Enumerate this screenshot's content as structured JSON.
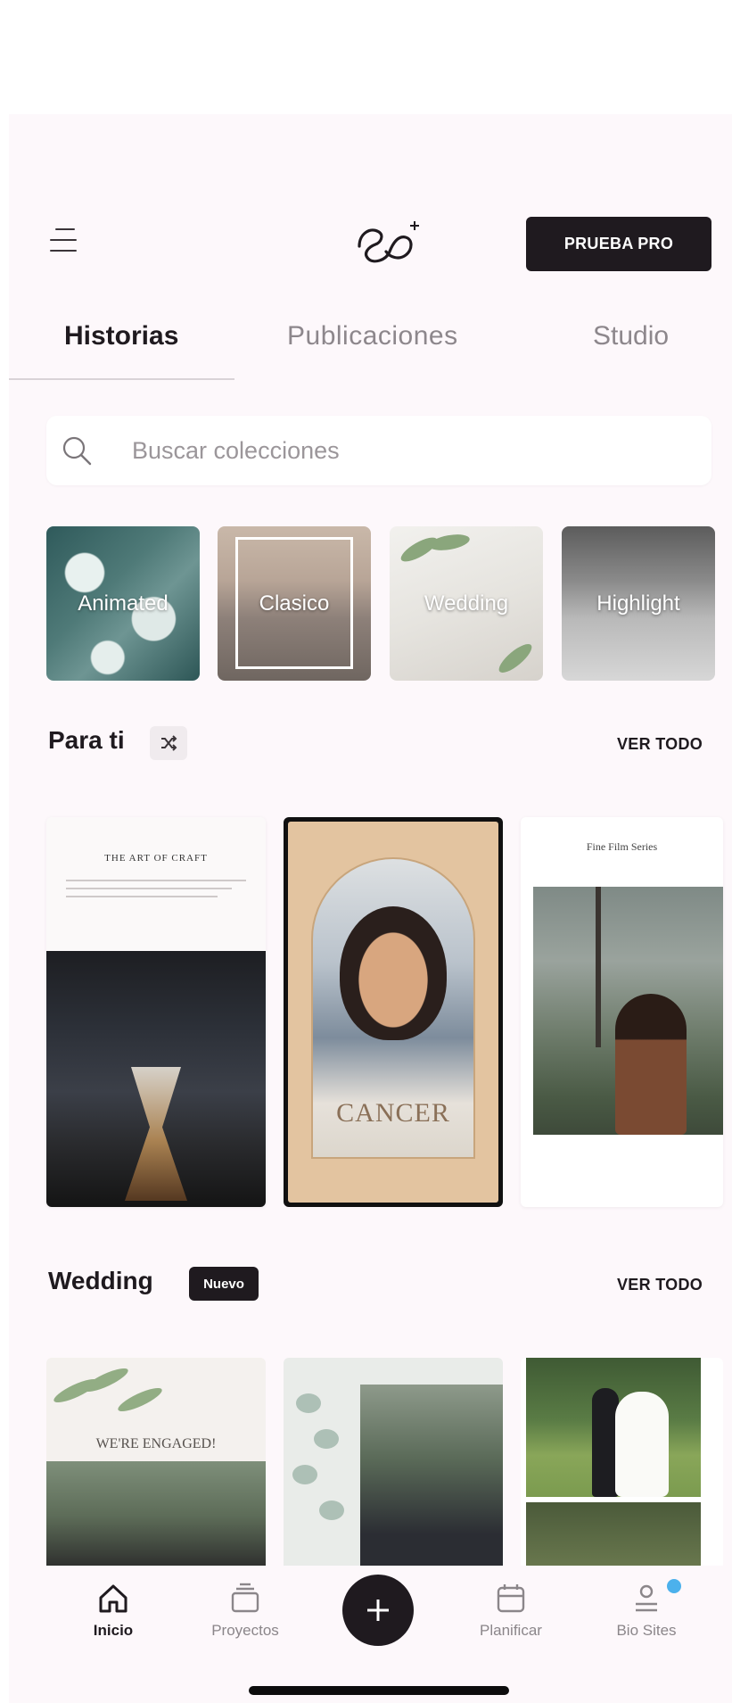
{
  "header": {
    "pro_button": "PRUEBA PRO"
  },
  "tabs": [
    "Historias",
    "Publicaciones",
    "Studio"
  ],
  "search": {
    "placeholder": "Buscar colecciones"
  },
  "collections": [
    "Animated",
    "Clasico",
    "Wedding",
    "Highlight"
  ],
  "sections": {
    "for_you": {
      "title": "Para ti",
      "see_all": "VER TODO",
      "cards": {
        "craft_title": "THE ART OF CRAFT",
        "cancer_word": "CANCER",
        "film_title": "Fine Film Series"
      }
    },
    "wedding": {
      "title": "Wedding",
      "badge": "Nuevo",
      "see_all": "VER TODO",
      "cards": {
        "engaged_title": "WE'RE ENGAGED!"
      }
    }
  },
  "bottom_nav": {
    "items": [
      "Inicio",
      "Proyectos",
      "Planificar",
      "Bio Sites"
    ],
    "active": "Inicio"
  },
  "colors": {
    "primary": "#1f1a1f",
    "background": "#fdf8fb",
    "inactive_text": "#8b868a",
    "notification_dot": "#4cb1ec"
  },
  "icons": [
    "menu-icon",
    "app-logo",
    "search-icon",
    "shuffle-icon",
    "home-icon",
    "projects-icon",
    "plus-icon",
    "calendar-icon",
    "bio-sites-icon"
  ]
}
